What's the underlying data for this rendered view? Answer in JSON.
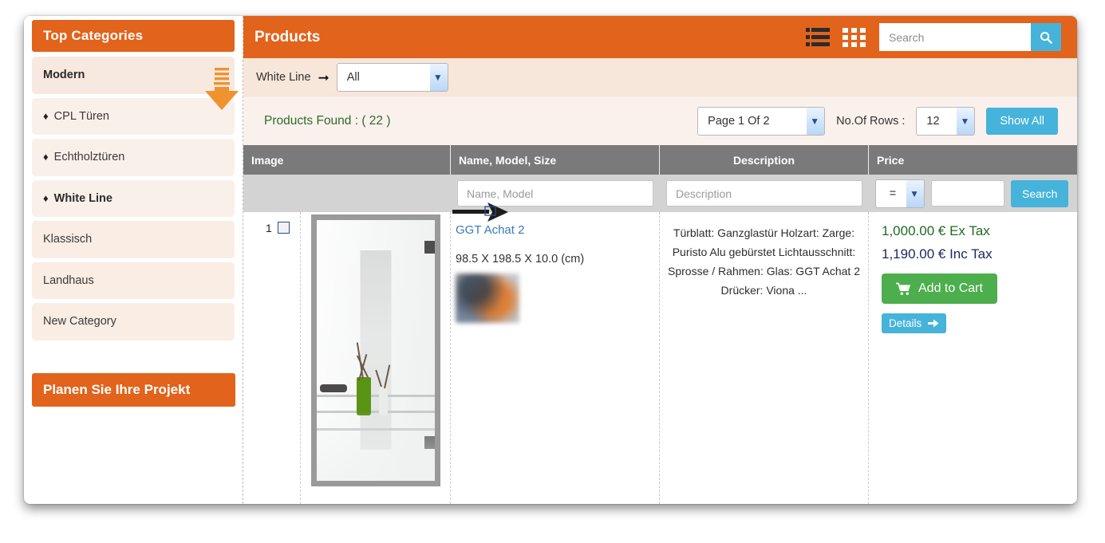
{
  "sidebar": {
    "title": "Top Categories",
    "items": [
      {
        "label": "Modern",
        "bullet": ""
      },
      {
        "label": "CPL Türen",
        "bullet": "♦"
      },
      {
        "label": "Echtholztüren",
        "bullet": "♦"
      },
      {
        "label": "White Line",
        "bullet": "♦"
      },
      {
        "label": "Klassisch",
        "bullet": ""
      },
      {
        "label": "Landhaus",
        "bullet": ""
      },
      {
        "label": "New Category",
        "bullet": ""
      }
    ],
    "promo_label": "Planen Sie Ihre Projekt"
  },
  "header": {
    "title": "Products",
    "list_view_icon": "list-view-icon",
    "grid_view_icon": "grid-view-icon",
    "search_placeholder": "Search",
    "search_value": "",
    "search_icon": "search-icon"
  },
  "filter_bar": {
    "label": "White Line",
    "arrow_icon": "arrow-right-icon",
    "category_selected": "All",
    "category_options": [
      "All"
    ]
  },
  "found_bar": {
    "found_text": "Products Found :  ( 22 )",
    "page_selected": "Page 1 Of 2",
    "page_options": [
      "Page 1 Of 2"
    ],
    "rows_label": "No.Of Rows  :",
    "rows_selected": "12",
    "rows_options": [
      "12"
    ],
    "show_all_label": "Show All"
  },
  "table": {
    "columns": [
      "Image",
      "Name, Model, Size",
      "Description",
      "Price"
    ],
    "filters": {
      "name_placeholder": "Name, Model",
      "name_value": "",
      "description_placeholder": "Description",
      "description_value": "",
      "operator_selected": "=",
      "operator_options": [
        "="
      ],
      "price_value": "",
      "search_label": "Search"
    },
    "rows": [
      {
        "index": "1",
        "selected": false,
        "image_alt": "glass door GGT Achat 2",
        "name": "GGT Achat 2",
        "size": "98.5 X 198.5 X 10.0 (cm)",
        "description": "Türblatt: Ganzglastür Holzart: Zarge: Puristo Alu gebürstet Lichtausschnitt: Sprosse / Rahmen: Glas: GGT Achat 2 Drücker: Viona ...",
        "price_ex": "1,000.00 € Ex Tax",
        "price_inc": "1,190.00 € Inc Tax",
        "add_to_cart_label": "Add to Cart",
        "cart_icon": "shopping-cart-icon",
        "details_label": "Details",
        "details_icon": "arrow-right-icon"
      }
    ]
  },
  "annotations": {
    "down_arrow_icon": "annotation-down-arrow",
    "right_arrow_icon": "annotation-right-arrow"
  },
  "colors": {
    "brand_orange": "#e2631b",
    "accent_blue": "#45b3da",
    "cart_green": "#4cae4c",
    "price_ex_green": "#1e6b1e",
    "price_inc_navy": "#1c2a63",
    "header_gray": "#7a7a7a",
    "filter_row_gray": "#d3d3d3"
  }
}
